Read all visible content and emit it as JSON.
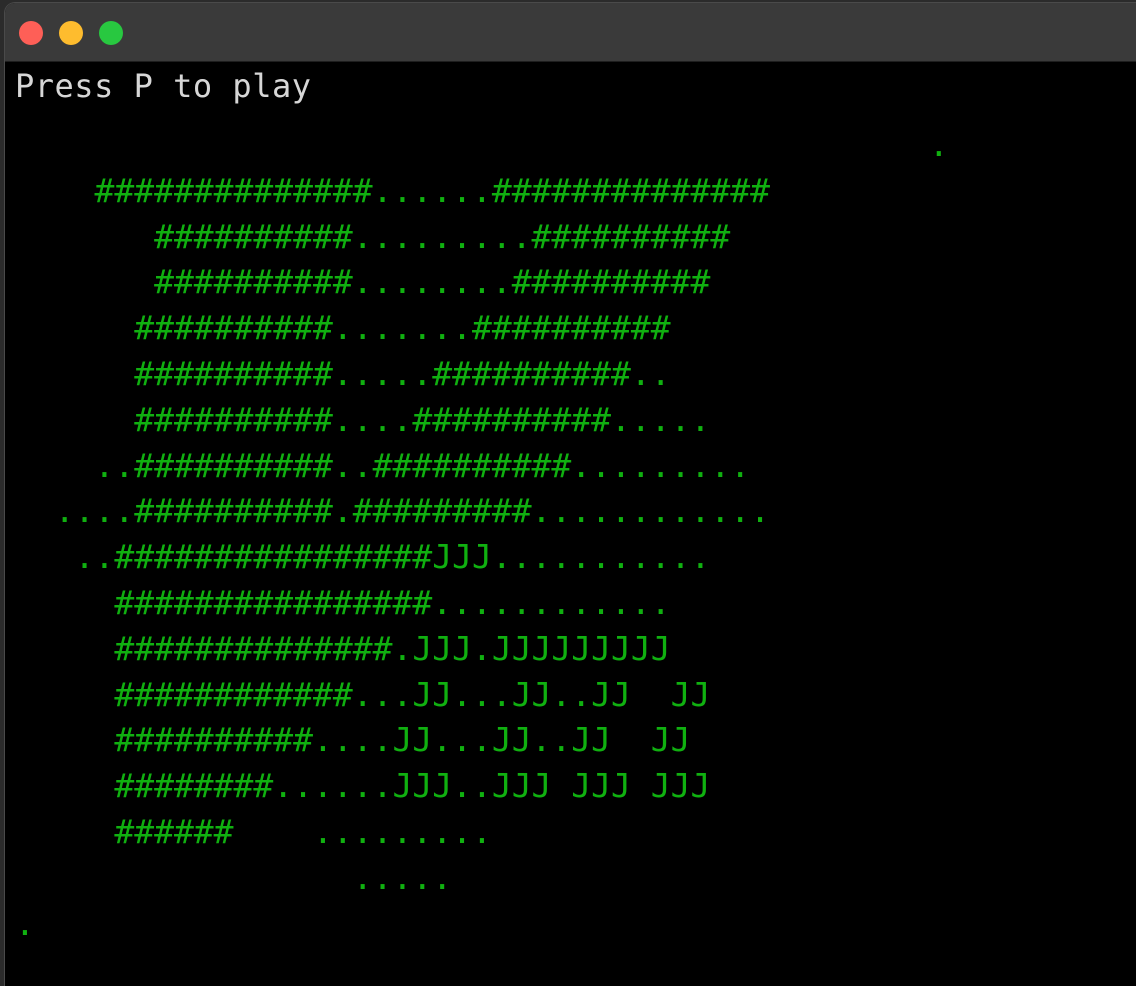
{
  "window": {
    "controls": [
      {
        "name": "close",
        "color": "#fe5f57"
      },
      {
        "name": "minimize",
        "color": "#febc2e"
      },
      {
        "name": "zoom",
        "color": "#28c840"
      }
    ]
  },
  "terminal": {
    "prompt": "Press P to play",
    "text_color": "#d7d7d7",
    "art_color": "#10b010",
    "background": "#000000",
    "art_lines": [
      "                                              .",
      "    ##############......##############",
      "       ##########.........##########",
      "       ##########........##########",
      "      ##########.......##########",
      "      ##########.....##########..",
      "      ##########....##########.....",
      "    ..##########..##########.........",
      "  ....##########.#########............",
      "   ..################JJJ...........",
      "     ################............",
      "     ##############.JJJ.JJJJJJJJJ",
      "     ############...JJ...JJ..JJ  JJ",
      "     ##########....JJ...JJ..JJ  JJ",
      "     ########......JJJ..JJJ JJJ JJJ",
      "     ######    .........",
      "                 .....",
      "."
    ]
  }
}
